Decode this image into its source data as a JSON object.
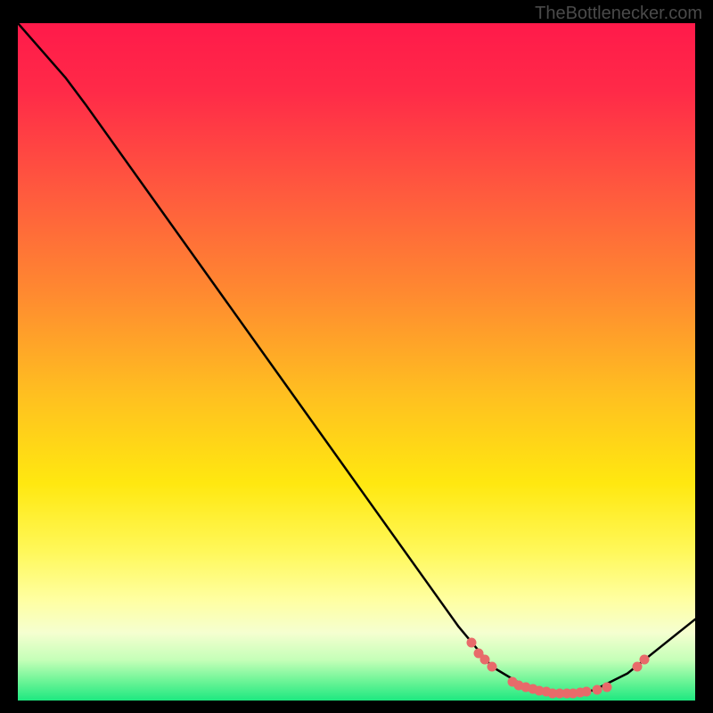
{
  "attribution": "TheBottlenecker.com",
  "chart_data": {
    "type": "line",
    "title": "",
    "xlabel": "",
    "ylabel": "",
    "xlim": [
      0,
      100
    ],
    "ylim": [
      0,
      100
    ],
    "curve": [
      {
        "x": 0,
        "y": 100
      },
      {
        "x": 7,
        "y": 92
      },
      {
        "x": 10,
        "y": 88
      },
      {
        "x": 20,
        "y": 74
      },
      {
        "x": 30,
        "y": 60
      },
      {
        "x": 40,
        "y": 46
      },
      {
        "x": 50,
        "y": 32
      },
      {
        "x": 60,
        "y": 18
      },
      {
        "x": 65,
        "y": 11
      },
      {
        "x": 70,
        "y": 5
      },
      {
        "x": 75,
        "y": 2
      },
      {
        "x": 80,
        "y": 1
      },
      {
        "x": 85,
        "y": 1.5
      },
      {
        "x": 90,
        "y": 4
      },
      {
        "x": 95,
        "y": 8
      },
      {
        "x": 100,
        "y": 12
      }
    ],
    "dots": [
      {
        "x": 67,
        "y": 8.5
      },
      {
        "x": 68,
        "y": 7
      },
      {
        "x": 69,
        "y": 6
      },
      {
        "x": 70,
        "y": 5
      },
      {
        "x": 73,
        "y": 2.8
      },
      {
        "x": 74,
        "y": 2.3
      },
      {
        "x": 75,
        "y": 2
      },
      {
        "x": 76,
        "y": 1.7
      },
      {
        "x": 77,
        "y": 1.5
      },
      {
        "x": 78,
        "y": 1.3
      },
      {
        "x": 79,
        "y": 1.1
      },
      {
        "x": 80,
        "y": 1
      },
      {
        "x": 81,
        "y": 1
      },
      {
        "x": 82,
        "y": 1.1
      },
      {
        "x": 83,
        "y": 1.2
      },
      {
        "x": 84,
        "y": 1.3
      },
      {
        "x": 85.5,
        "y": 1.6
      },
      {
        "x": 87,
        "y": 2
      },
      {
        "x": 91.5,
        "y": 5
      },
      {
        "x": 92.5,
        "y": 6
      }
    ],
    "gradient_stops": [
      {
        "offset": 0,
        "color": "#ff1a4a"
      },
      {
        "offset": 10,
        "color": "#ff2a48"
      },
      {
        "offset": 25,
        "color": "#ff5a3e"
      },
      {
        "offset": 40,
        "color": "#ff8a30"
      },
      {
        "offset": 55,
        "color": "#ffc020"
      },
      {
        "offset": 68,
        "color": "#ffe810"
      },
      {
        "offset": 78,
        "color": "#fff85a"
      },
      {
        "offset": 85,
        "color": "#ffffa0"
      },
      {
        "offset": 90,
        "color": "#f5ffd0"
      },
      {
        "offset": 94,
        "color": "#c5ffb8"
      },
      {
        "offset": 97,
        "color": "#70f598"
      },
      {
        "offset": 100,
        "color": "#1ee880"
      }
    ]
  }
}
